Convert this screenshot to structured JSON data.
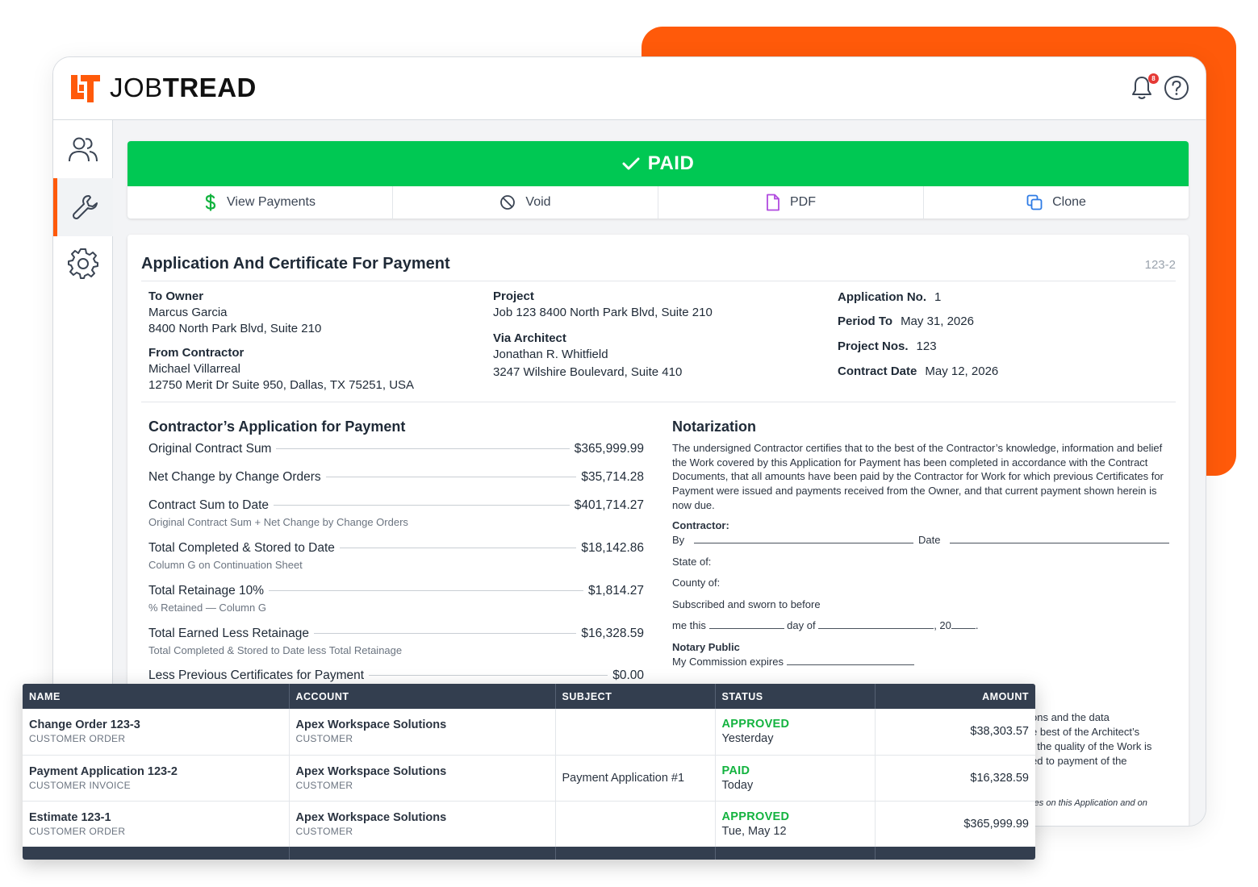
{
  "brand": {
    "name_light": "JOB",
    "name_bold": "TREAD",
    "accent_color": "#ff5a0a"
  },
  "topbar": {
    "notification_count": "8"
  },
  "banner": {
    "status": "PAID",
    "color": "#00c853"
  },
  "actions": {
    "view_payments": "View Payments",
    "void": "Void",
    "pdf": "PDF",
    "clone": "Clone"
  },
  "document": {
    "title": "Application And Certificate For Payment",
    "number": "123-2",
    "to_owner": {
      "label": "To Owner",
      "name": "Marcus Garcia",
      "address": "8400 North Park Blvd, Suite 210"
    },
    "from_contractor": {
      "label": "From Contractor",
      "name": "Michael Villarreal",
      "address": "12750 Merit Dr Suite 950, Dallas, TX 75251, USA"
    },
    "project": {
      "label": "Project",
      "value": "Job 123 8400 North Park Blvd, Suite 210"
    },
    "via_architect": {
      "label": "Via Architect",
      "name": "Jonathan R. Whitfield",
      "address": "3247 Wilshire Boulevard, Suite 410"
    },
    "application_no": {
      "label": "Application No.",
      "value": "1"
    },
    "period_to": {
      "label": "Period To",
      "value": "May 31, 2026"
    },
    "project_nos": {
      "label": "Project Nos.",
      "value": "123"
    },
    "contract_date": {
      "label": "Contract Date",
      "value": "May 12, 2026"
    }
  },
  "application": {
    "title": "Contractor’s Application for Payment",
    "lines": [
      {
        "label": "Original Contract Sum",
        "value": "$365,999.99",
        "sub": ""
      },
      {
        "label": "Net Change by Change Orders",
        "value": "$35,714.28",
        "sub": ""
      },
      {
        "label": "Contract Sum to Date",
        "value": "$401,714.27",
        "sub": "Original Contract Sum + Net Change by Change Orders"
      },
      {
        "label": "Total Completed & Stored to Date",
        "value": "$18,142.86",
        "sub": "Column G on Continuation Sheet"
      },
      {
        "label": "Total Retainage 10%",
        "value": "$1,814.27",
        "sub": "% Retained — Column G"
      },
      {
        "label": "Total Earned Less Retainage",
        "value": "$16,328.59",
        "sub": "Total Completed & Stored to Date less Total Retainage"
      },
      {
        "label": "Less Previous Certificates for Payment",
        "value": "$0.00",
        "sub": ""
      }
    ]
  },
  "notarization": {
    "title": "Notarization",
    "body": "The undersigned Contractor certifies that to the best of the Contractor’s knowledge, information and belief the Work covered by this Application for Payment has been completed in accordance with the Contract Documents, that all amounts have been paid by the Contractor for Work for which previous Certificates for Payment were issued and payments received from the Owner, and that current payment shown herein is now due.",
    "contractor_label": "Contractor:",
    "by": "By",
    "date": "Date",
    "state_of": "State of:",
    "county_of": "County of:",
    "subscribed": "Subscribed and sworn to before",
    "me_this": "me this",
    "day_of": "day of",
    "comma_20": ", 20",
    "period": ".",
    "notary_public": "Notary Public",
    "commission": "My Commission expires",
    "partial_lines": [
      "ons and the data",
      "e best of the Architect’s",
      ", the quality of the Work is",
      "ed to payment of the"
    ],
    "partial_italic": "res on this Application and on"
  },
  "table": {
    "headers": [
      "NAME",
      "ACCOUNT",
      "SUBJECT",
      "STATUS",
      "AMOUNT"
    ],
    "rows": [
      {
        "name": "Change Order 123-3",
        "type": "CUSTOMER ORDER",
        "account": "Apex Workspace Solutions",
        "account_type": "CUSTOMER",
        "subject": "",
        "status": "APPROVED",
        "date": "Yesterday",
        "amount": "$38,303.57"
      },
      {
        "name": "Payment Application 123-2",
        "type": "CUSTOMER INVOICE",
        "account": "Apex Workspace Solutions",
        "account_type": "CUSTOMER",
        "subject": "Payment Application #1",
        "status": "PAID",
        "date": "Today",
        "amount": "$16,328.59"
      },
      {
        "name": "Estimate 123-1",
        "type": "CUSTOMER ORDER",
        "account": "Apex Workspace Solutions",
        "account_type": "CUSTOMER",
        "subject": "",
        "status": "APPROVED",
        "date": "Tue, May 12",
        "amount": "$365,999.99"
      }
    ]
  },
  "icons": {
    "sidebar": [
      "users-icon",
      "wrench-icon",
      "gear-icon"
    ],
    "topbar": [
      "bell-icon",
      "help-icon"
    ],
    "actions": [
      "dollar-icon",
      "void-icon",
      "pdf-icon",
      "clone-icon"
    ]
  }
}
